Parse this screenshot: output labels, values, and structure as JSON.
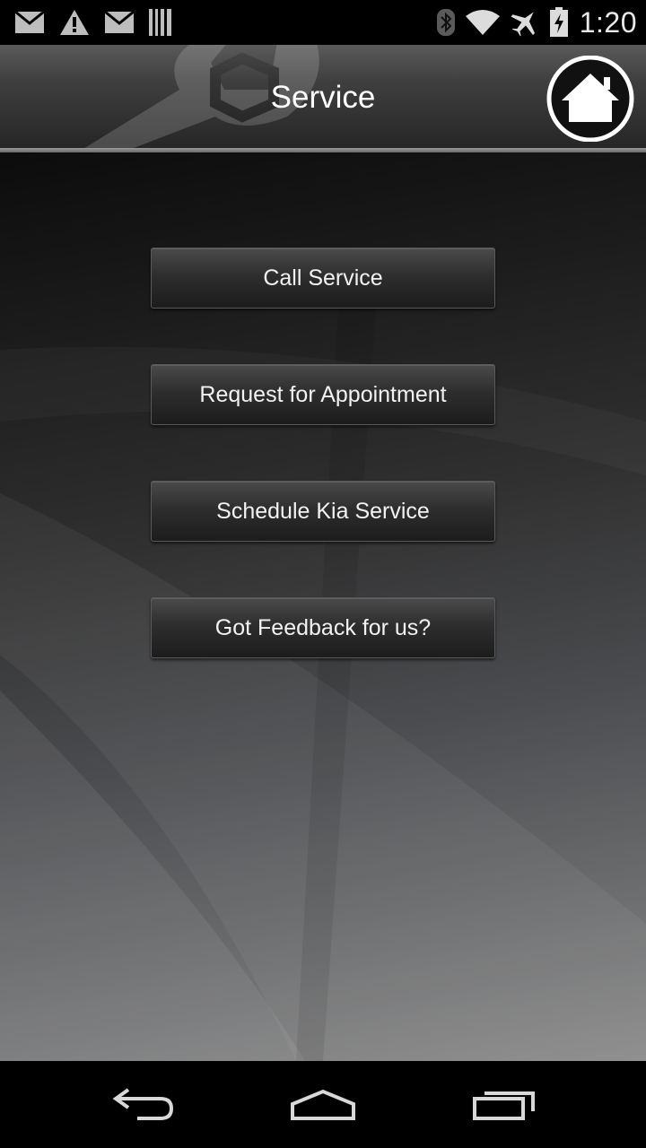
{
  "status_bar": {
    "time": "1:20",
    "left_icons": [
      "gmail-icon",
      "warning-icon",
      "gmail-icon",
      "barcode-icon"
    ],
    "right_icons": [
      "bluetooth-icon",
      "wifi-icon",
      "airplane-mode-icon",
      "battery-charging-icon"
    ]
  },
  "header": {
    "title": "Service",
    "home_icon": "home-icon"
  },
  "buttons": {
    "call_service": "Call Service",
    "request_appointment": "Request for Appointment",
    "schedule_service": "Schedule Kia Service",
    "feedback": "Got Feedback for us?"
  },
  "nav_bar": {
    "icons": [
      "back-icon",
      "home-nav-icon",
      "recents-icon"
    ]
  },
  "colors": {
    "status_bar_bg": "#000000",
    "header_top": "#5a5a5a",
    "header_bottom": "#262626",
    "button_text": "#f2f2f2"
  }
}
